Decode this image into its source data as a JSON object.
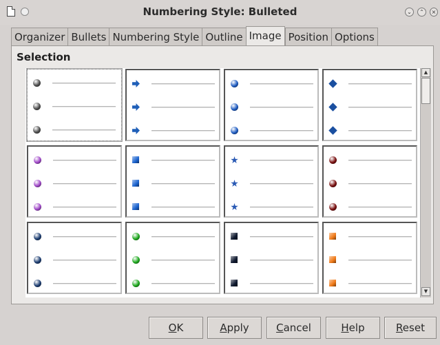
{
  "window": {
    "title": "Numbering Style: Bulleted",
    "buttons": [
      "minimize",
      "maximize",
      "close"
    ]
  },
  "tabs": [
    {
      "label": "Organizer",
      "active": false
    },
    {
      "label": "Bullets",
      "active": false
    },
    {
      "label": "Numbering Style",
      "active": false
    },
    {
      "label": "Outline",
      "active": false
    },
    {
      "label": "Image",
      "active": true
    },
    {
      "label": "Position",
      "active": false
    },
    {
      "label": "Options",
      "active": false
    }
  ],
  "section": {
    "title": "Selection"
  },
  "gallery": {
    "selected_index": 0,
    "items": [
      {
        "icon": "gray-sphere-bullet-icon",
        "color": "#505050"
      },
      {
        "icon": "blue-arrow-bullet-icon",
        "color": "#1f5fb8"
      },
      {
        "icon": "blue-sphere-bullet-icon",
        "color": "#1e5cc2"
      },
      {
        "icon": "blue-diamond-arrow-bullet-icon",
        "color": "#1a4fa0"
      },
      {
        "icon": "purple-sphere-bullet-icon",
        "color": "#a048c8"
      },
      {
        "icon": "blue-cube-bullet-icon",
        "color": "#1c64d0"
      },
      {
        "icon": "blue-star-bullet-icon",
        "color": "#2a5ab4"
      },
      {
        "icon": "dark-red-sphere-bullet-icon",
        "color": "#7a1010"
      },
      {
        "icon": "navy-sphere-bullet-icon",
        "color": "#1d3e72"
      },
      {
        "icon": "green-sphere-bullet-icon",
        "color": "#1faa1f"
      },
      {
        "icon": "black-square-bullet-icon",
        "color": "#101a30"
      },
      {
        "icon": "orange-square-bullet-icon",
        "color": "#f07a18"
      }
    ]
  },
  "buttons": {
    "ok": {
      "pre": "",
      "mnemonic": "O",
      "post": "K"
    },
    "apply": {
      "pre": "",
      "mnemonic": "A",
      "post": "pply"
    },
    "cancel": {
      "pre": "",
      "mnemonic": "C",
      "post": "ancel"
    },
    "help": {
      "pre": "",
      "mnemonic": "H",
      "post": "elp"
    },
    "reset": {
      "pre": "",
      "mnemonic": "R",
      "post": "eset"
    }
  }
}
